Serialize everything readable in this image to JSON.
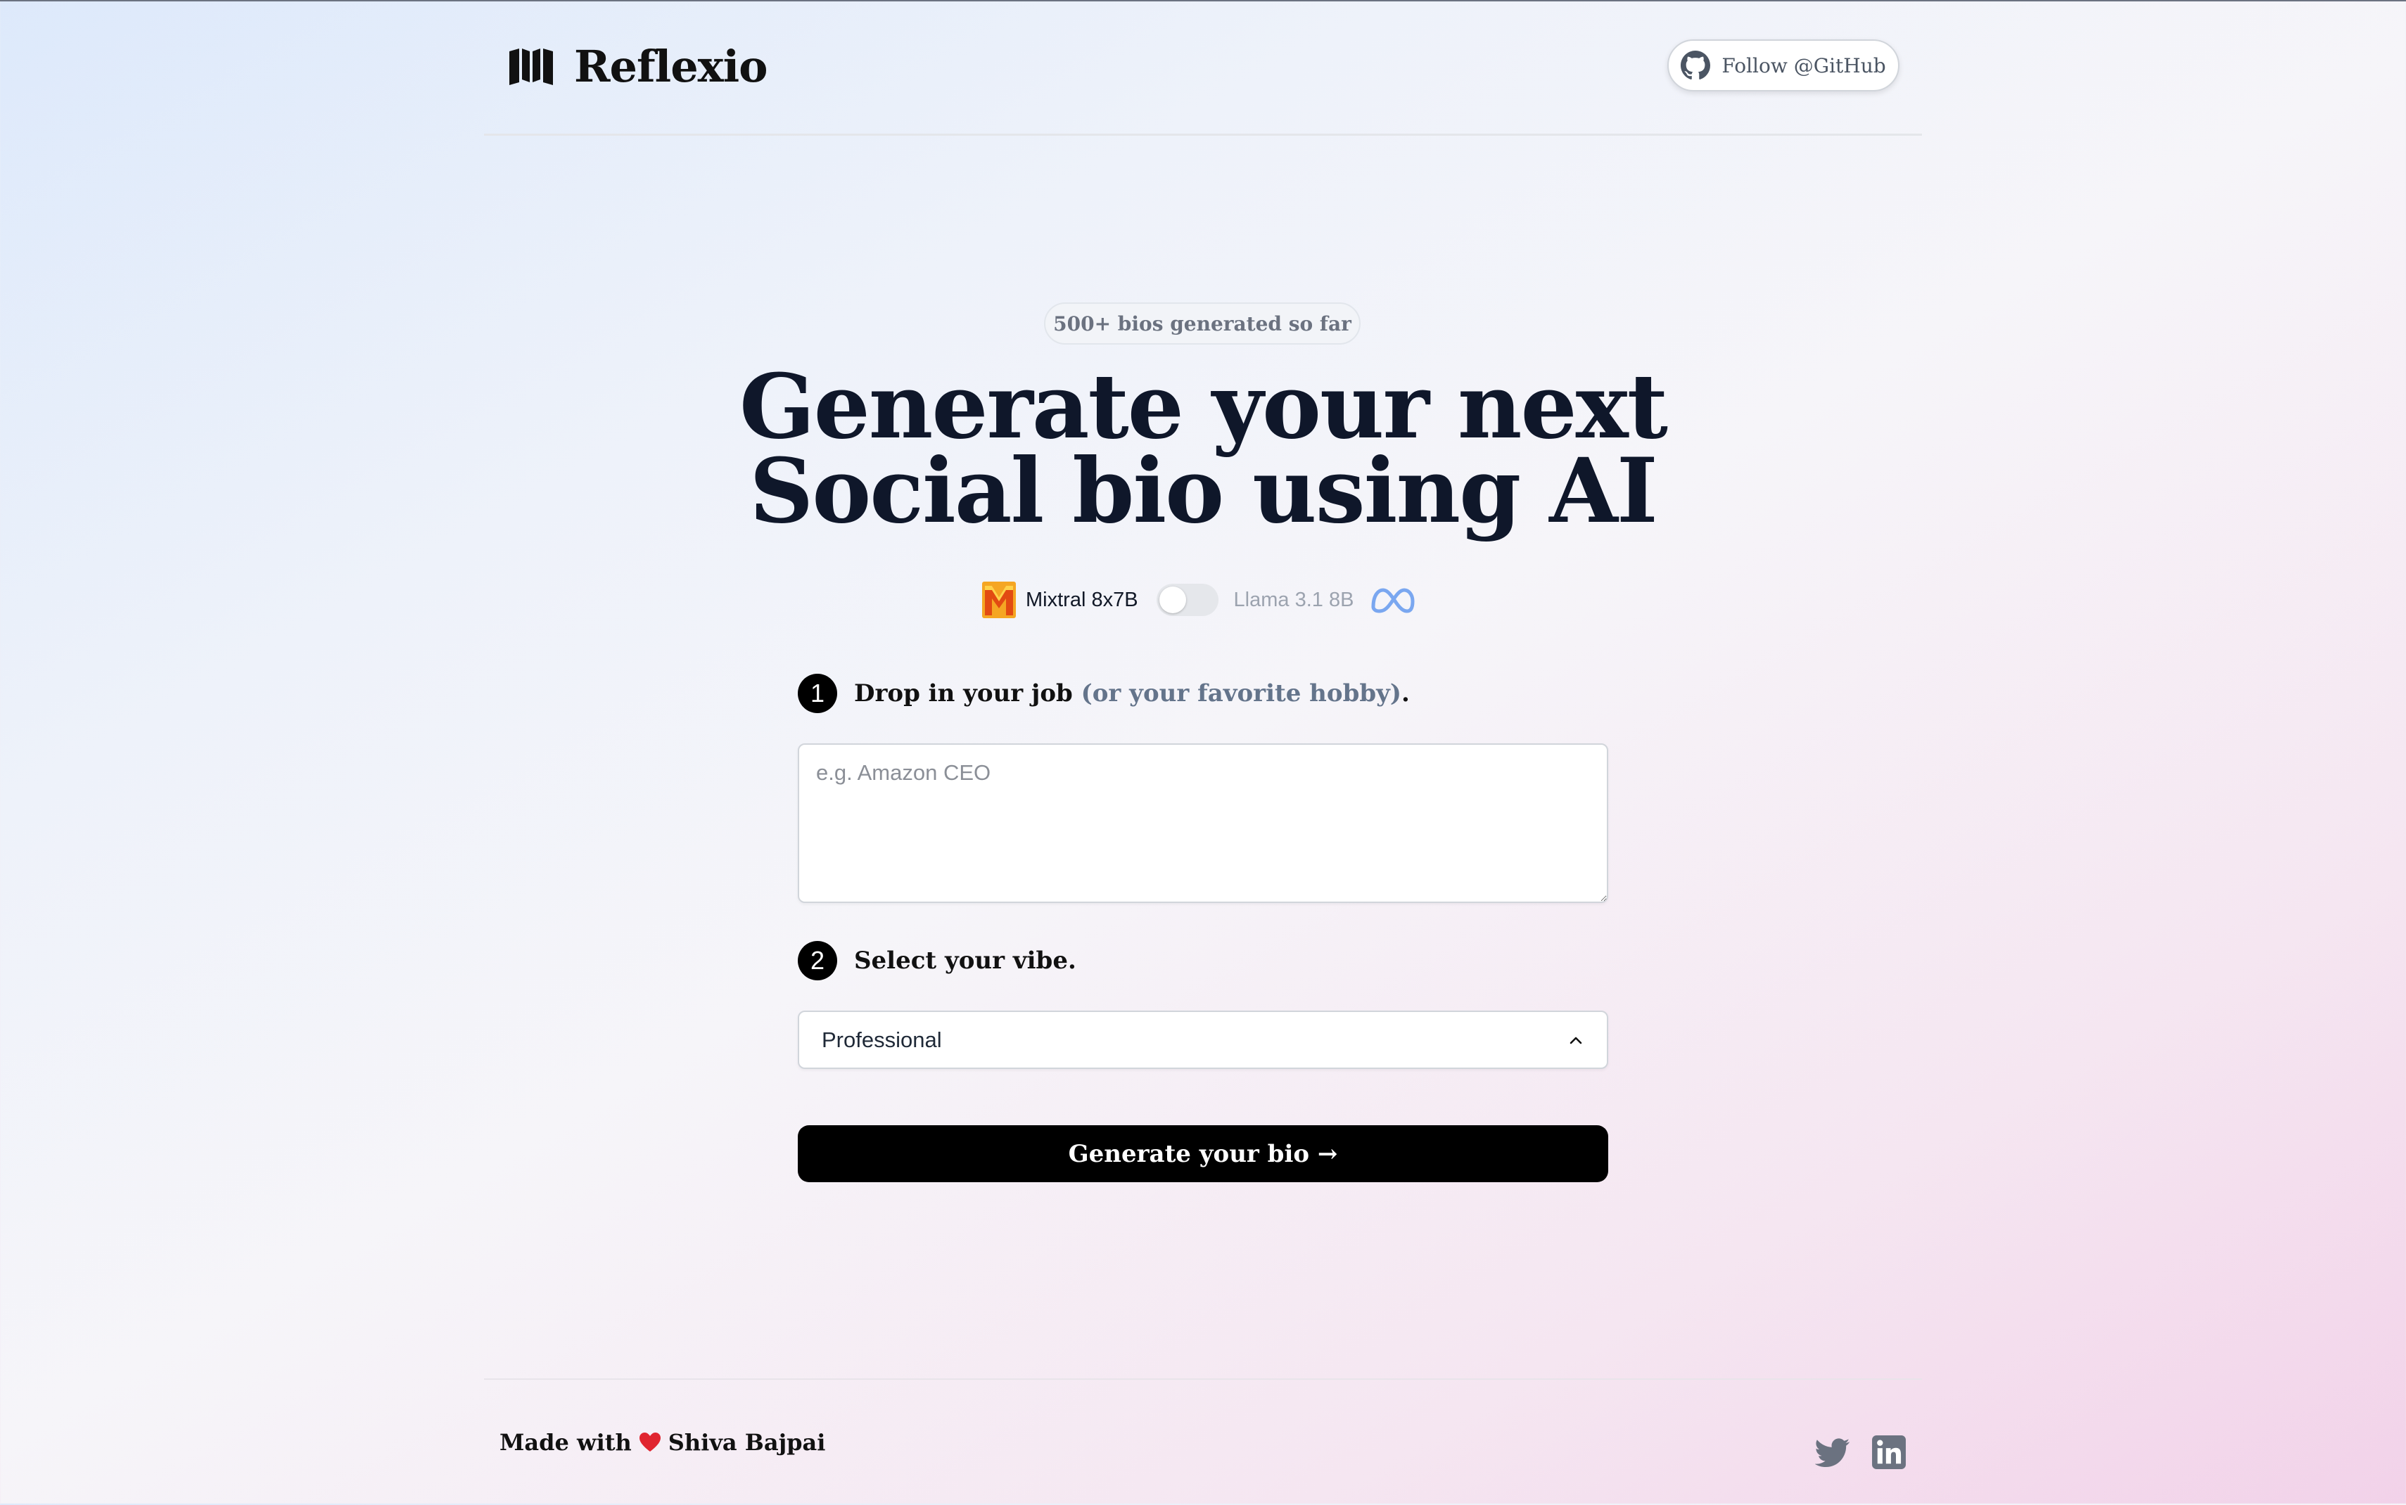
{
  "header": {
    "brand": "Reflexio",
    "github_label": "Follow @GitHub"
  },
  "hero": {
    "badge": "500+ bios generated so far",
    "title_line1": "Generate your next",
    "title_line2": "Social bio using AI"
  },
  "models": {
    "option_a": "Mixtral 8x7B",
    "option_b": "Llama 3.1 8B",
    "toggle_on": false
  },
  "step1": {
    "number": "1",
    "label": "Drop in your job",
    "hint": "(or your favorite hobby)",
    "suffix": ".",
    "placeholder": "e.g. Amazon CEO",
    "value": ""
  },
  "step2": {
    "number": "2",
    "label": "Select your vibe.",
    "selected": "Professional"
  },
  "actions": {
    "generate_label": "Generate your bio →"
  },
  "footer": {
    "made_with": "Made with",
    "author": "Shiva Bajpai"
  },
  "icons": {
    "logo": "book-open-icon",
    "github": "github-icon",
    "mistral": "mistral-icon",
    "meta": "meta-icon",
    "chevron": "chevron-up-icon",
    "heart": "heart-icon",
    "twitter": "twitter-icon",
    "linkedin": "linkedin-icon"
  }
}
